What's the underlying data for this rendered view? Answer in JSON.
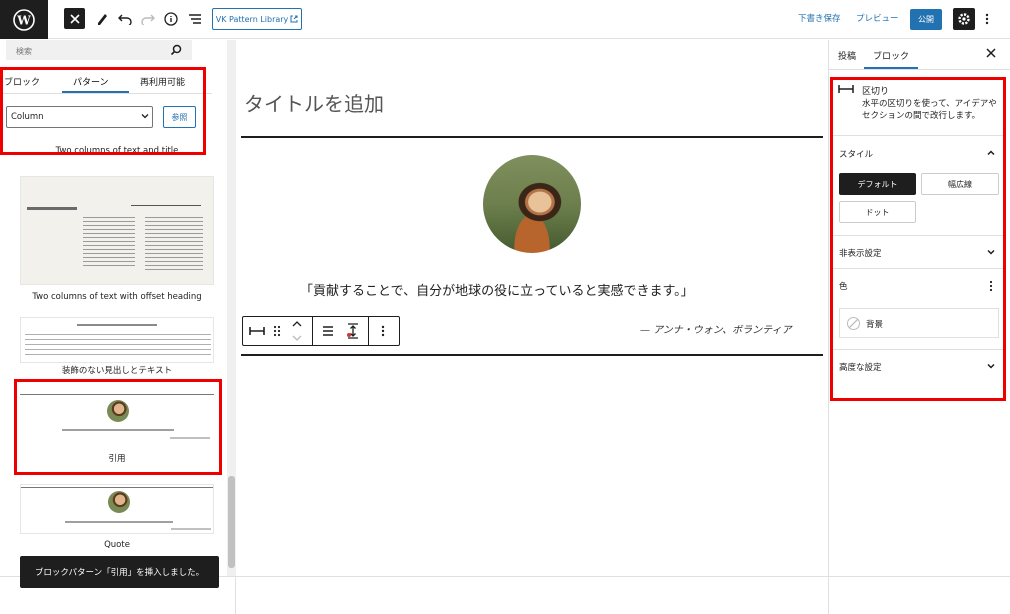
{
  "toolbar": {
    "vk_label": "VK Pattern Library",
    "draft_label": "下書き保存",
    "preview_label": "プレビュー",
    "publish_label": "公開"
  },
  "inserter": {
    "search_placeholder": "検索",
    "tabs": [
      {
        "label": "ブロック"
      },
      {
        "label": "パターン"
      },
      {
        "label": "再利用可能"
      }
    ],
    "category_selected": "Column",
    "browse_label": "参照",
    "patterns": [
      {
        "label": "Two columns of text and title"
      },
      {
        "label": "Two columns of text with offset heading"
      },
      {
        "label": "装飾のない見出しとテキスト"
      },
      {
        "label": "引用"
      },
      {
        "label": "Quote"
      }
    ]
  },
  "editor": {
    "title_placeholder": "タイトルを追加",
    "quote": "「貢献することで、自分が地球の役に立っていると実感できます。」",
    "citation": "— アンナ・ウォン、ボランティア"
  },
  "sidebar": {
    "tabs": [
      {
        "label": "投稿"
      },
      {
        "label": "ブロック"
      }
    ],
    "block_name": "区切り",
    "block_description": "水平の区切りを使って、アイデアやセクションの間で改行します。",
    "panels": {
      "styles": "スタイル",
      "visibility": "非表示設定",
      "color": "色",
      "advanced": "高度な設定"
    },
    "style_options": [
      "デフォルト",
      "幅広線",
      "ドット"
    ],
    "color_background": "背景"
  },
  "snackbar": "ブロックパターン「引用」を挿入しました。",
  "colors": {
    "accent": "#2271b1",
    "highlight": "#e00000",
    "dark": "#1e1e1e"
  }
}
